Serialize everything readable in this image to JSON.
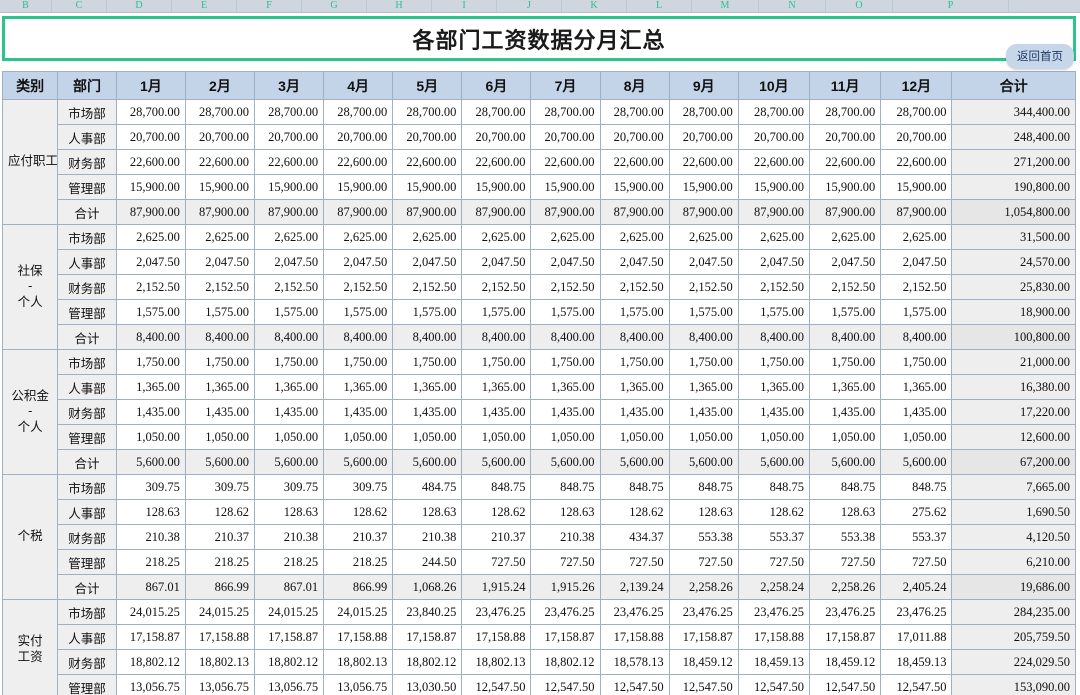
{
  "sheet": {
    "column_letters": [
      "B",
      "C",
      "D",
      "E",
      "F",
      "G",
      "H",
      "I",
      "J",
      "K",
      "L",
      "M",
      "N",
      "O",
      "P"
    ],
    "title": "各部门工资数据分月汇总",
    "home_button": "返回首页",
    "headers": [
      "类别",
      "部门",
      "1月",
      "2月",
      "3月",
      "4月",
      "5月",
      "6月",
      "7月",
      "8月",
      "9月",
      "10月",
      "11月",
      "12月",
      "合计"
    ],
    "colors": {
      "title_border": "#2bc48a",
      "header_bg": "#c3d4e9",
      "category_bg": "#efefef",
      "total_row_bg": "#eeeeee",
      "column_letter": "#2cc08a",
      "home_button_bg": "#c8d6ea"
    },
    "sections": [
      {
        "category": "应付职工薪酬",
        "rows": [
          {
            "dept": "市场部",
            "is_sum": false,
            "values": [
              "28,700.00",
              "28,700.00",
              "28,700.00",
              "28,700.00",
              "28,700.00",
              "28,700.00",
              "28,700.00",
              "28,700.00",
              "28,700.00",
              "28,700.00",
              "28,700.00",
              "28,700.00"
            ],
            "total": "344,400.00"
          },
          {
            "dept": "人事部",
            "is_sum": false,
            "values": [
              "20,700.00",
              "20,700.00",
              "20,700.00",
              "20,700.00",
              "20,700.00",
              "20,700.00",
              "20,700.00",
              "20,700.00",
              "20,700.00",
              "20,700.00",
              "20,700.00",
              "20,700.00"
            ],
            "total": "248,400.00"
          },
          {
            "dept": "财务部",
            "is_sum": false,
            "values": [
              "22,600.00",
              "22,600.00",
              "22,600.00",
              "22,600.00",
              "22,600.00",
              "22,600.00",
              "22,600.00",
              "22,600.00",
              "22,600.00",
              "22,600.00",
              "22,600.00",
              "22,600.00"
            ],
            "total": "271,200.00"
          },
          {
            "dept": "管理部",
            "is_sum": false,
            "values": [
              "15,900.00",
              "15,900.00",
              "15,900.00",
              "15,900.00",
              "15,900.00",
              "15,900.00",
              "15,900.00",
              "15,900.00",
              "15,900.00",
              "15,900.00",
              "15,900.00",
              "15,900.00"
            ],
            "total": "190,800.00"
          },
          {
            "dept": "合计",
            "is_sum": true,
            "values": [
              "87,900.00",
              "87,900.00",
              "87,900.00",
              "87,900.00",
              "87,900.00",
              "87,900.00",
              "87,900.00",
              "87,900.00",
              "87,900.00",
              "87,900.00",
              "87,900.00",
              "87,900.00"
            ],
            "total": "1,054,800.00"
          }
        ]
      },
      {
        "category": "社保\n-\n个人",
        "rows": [
          {
            "dept": "市场部",
            "is_sum": false,
            "values": [
              "2,625.00",
              "2,625.00",
              "2,625.00",
              "2,625.00",
              "2,625.00",
              "2,625.00",
              "2,625.00",
              "2,625.00",
              "2,625.00",
              "2,625.00",
              "2,625.00",
              "2,625.00"
            ],
            "total": "31,500.00"
          },
          {
            "dept": "人事部",
            "is_sum": false,
            "values": [
              "2,047.50",
              "2,047.50",
              "2,047.50",
              "2,047.50",
              "2,047.50",
              "2,047.50",
              "2,047.50",
              "2,047.50",
              "2,047.50",
              "2,047.50",
              "2,047.50",
              "2,047.50"
            ],
            "total": "24,570.00"
          },
          {
            "dept": "财务部",
            "is_sum": false,
            "values": [
              "2,152.50",
              "2,152.50",
              "2,152.50",
              "2,152.50",
              "2,152.50",
              "2,152.50",
              "2,152.50",
              "2,152.50",
              "2,152.50",
              "2,152.50",
              "2,152.50",
              "2,152.50"
            ],
            "total": "25,830.00"
          },
          {
            "dept": "管理部",
            "is_sum": false,
            "values": [
              "1,575.00",
              "1,575.00",
              "1,575.00",
              "1,575.00",
              "1,575.00",
              "1,575.00",
              "1,575.00",
              "1,575.00",
              "1,575.00",
              "1,575.00",
              "1,575.00",
              "1,575.00"
            ],
            "total": "18,900.00"
          },
          {
            "dept": "合计",
            "is_sum": true,
            "values": [
              "8,400.00",
              "8,400.00",
              "8,400.00",
              "8,400.00",
              "8,400.00",
              "8,400.00",
              "8,400.00",
              "8,400.00",
              "8,400.00",
              "8,400.00",
              "8,400.00",
              "8,400.00"
            ],
            "total": "100,800.00"
          }
        ]
      },
      {
        "category": "公积金\n-\n个人",
        "rows": [
          {
            "dept": "市场部",
            "is_sum": false,
            "values": [
              "1,750.00",
              "1,750.00",
              "1,750.00",
              "1,750.00",
              "1,750.00",
              "1,750.00",
              "1,750.00",
              "1,750.00",
              "1,750.00",
              "1,750.00",
              "1,750.00",
              "1,750.00"
            ],
            "total": "21,000.00"
          },
          {
            "dept": "人事部",
            "is_sum": false,
            "values": [
              "1,365.00",
              "1,365.00",
              "1,365.00",
              "1,365.00",
              "1,365.00",
              "1,365.00",
              "1,365.00",
              "1,365.00",
              "1,365.00",
              "1,365.00",
              "1,365.00",
              "1,365.00"
            ],
            "total": "16,380.00"
          },
          {
            "dept": "财务部",
            "is_sum": false,
            "values": [
              "1,435.00",
              "1,435.00",
              "1,435.00",
              "1,435.00",
              "1,435.00",
              "1,435.00",
              "1,435.00",
              "1,435.00",
              "1,435.00",
              "1,435.00",
              "1,435.00",
              "1,435.00"
            ],
            "total": "17,220.00"
          },
          {
            "dept": "管理部",
            "is_sum": false,
            "values": [
              "1,050.00",
              "1,050.00",
              "1,050.00",
              "1,050.00",
              "1,050.00",
              "1,050.00",
              "1,050.00",
              "1,050.00",
              "1,050.00",
              "1,050.00",
              "1,050.00",
              "1,050.00"
            ],
            "total": "12,600.00"
          },
          {
            "dept": "合计",
            "is_sum": true,
            "values": [
              "5,600.00",
              "5,600.00",
              "5,600.00",
              "5,600.00",
              "5,600.00",
              "5,600.00",
              "5,600.00",
              "5,600.00",
              "5,600.00",
              "5,600.00",
              "5,600.00",
              "5,600.00"
            ],
            "total": "67,200.00"
          }
        ]
      },
      {
        "category": "个税",
        "rows": [
          {
            "dept": "市场部",
            "is_sum": false,
            "values": [
              "309.75",
              "309.75",
              "309.75",
              "309.75",
              "484.75",
              "848.75",
              "848.75",
              "848.75",
              "848.75",
              "848.75",
              "848.75",
              "848.75"
            ],
            "total": "7,665.00"
          },
          {
            "dept": "人事部",
            "is_sum": false,
            "values": [
              "128.63",
              "128.62",
              "128.63",
              "128.62",
              "128.63",
              "128.62",
              "128.63",
              "128.62",
              "128.63",
              "128.62",
              "128.63",
              "275.62"
            ],
            "total": "1,690.50"
          },
          {
            "dept": "财务部",
            "is_sum": false,
            "values": [
              "210.38",
              "210.37",
              "210.38",
              "210.37",
              "210.38",
              "210.37",
              "210.38",
              "434.37",
              "553.38",
              "553.37",
              "553.38",
              "553.37"
            ],
            "total": "4,120.50"
          },
          {
            "dept": "管理部",
            "is_sum": false,
            "values": [
              "218.25",
              "218.25",
              "218.25",
              "218.25",
              "244.50",
              "727.50",
              "727.50",
              "727.50",
              "727.50",
              "727.50",
              "727.50",
              "727.50"
            ],
            "total": "6,210.00"
          },
          {
            "dept": "合计",
            "is_sum": true,
            "values": [
              "867.01",
              "866.99",
              "867.01",
              "866.99",
              "1,068.26",
              "1,915.24",
              "1,915.26",
              "2,139.24",
              "2,258.26",
              "2,258.24",
              "2,258.26",
              "2,405.24"
            ],
            "total": "19,686.00"
          }
        ]
      },
      {
        "category": "实付\n工资",
        "rows": [
          {
            "dept": "市场部",
            "is_sum": false,
            "values": [
              "24,015.25",
              "24,015.25",
              "24,015.25",
              "24,015.25",
              "23,840.25",
              "23,476.25",
              "23,476.25",
              "23,476.25",
              "23,476.25",
              "23,476.25",
              "23,476.25",
              "23,476.25"
            ],
            "total": "284,235.00"
          },
          {
            "dept": "人事部",
            "is_sum": false,
            "values": [
              "17,158.87",
              "17,158.88",
              "17,158.87",
              "17,158.88",
              "17,158.87",
              "17,158.88",
              "17,158.87",
              "17,158.88",
              "17,158.87",
              "17,158.88",
              "17,158.87",
              "17,011.88"
            ],
            "total": "205,759.50"
          },
          {
            "dept": "财务部",
            "is_sum": false,
            "values": [
              "18,802.12",
              "18,802.13",
              "18,802.12",
              "18,802.13",
              "18,802.12",
              "18,802.13",
              "18,802.12",
              "18,578.13",
              "18,459.12",
              "18,459.13",
              "18,459.12",
              "18,459.13"
            ],
            "total": "224,029.50"
          },
          {
            "dept": "管理部",
            "is_sum": false,
            "values": [
              "13,056.75",
              "13,056.75",
              "13,056.75",
              "13,056.75",
              "13,030.50",
              "12,547.50",
              "12,547.50",
              "12,547.50",
              "12,547.50",
              "12,547.50",
              "12,547.50",
              "12,547.50"
            ],
            "total": "153,090.00"
          }
        ]
      }
    ]
  }
}
